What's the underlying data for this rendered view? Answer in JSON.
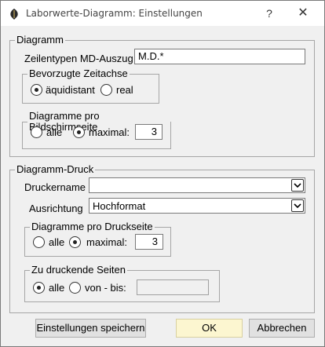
{
  "window": {
    "title": "Laborwerte-Diagramm: Einstellungen",
    "help_label": "?",
    "close_label": "✕"
  },
  "diagramm": {
    "legend": "Diagramm",
    "zeilentypen_label": "Zeilentypen MD-Auszug",
    "zeilentypen_value": "M.D.*",
    "zeitachse": {
      "legend": "Bevorzugte Zeitachse",
      "options": [
        "äquidistant",
        "real"
      ],
      "selected": "äquidistant"
    },
    "pro_bildschirmseite": {
      "legend": "Diagramme pro Bildschirmseite",
      "alle_label": "alle",
      "maximal_label": "maximal:",
      "selected": "maximal",
      "maximal_value": "3"
    }
  },
  "druck": {
    "legend": "Diagramm-Druck",
    "druckername_label": "Druckername",
    "druckername_value": "",
    "ausrichtung_label": "Ausrichtung",
    "ausrichtung_value": "Hochformat",
    "pro_druckseite": {
      "legend": "Diagramme pro Druckseite",
      "alle_label": "alle",
      "maximal_label": "maximal:",
      "selected": "maximal",
      "maximal_value": "3"
    },
    "seiten": {
      "legend": "Zu druckende Seiten",
      "alle_label": "alle",
      "von_bis_label": "von - bis:",
      "selected": "alle",
      "von_bis_value": ""
    }
  },
  "buttons": {
    "save": "Einstellungen speichern",
    "ok": "OK",
    "cancel": "Abbrechen"
  },
  "colors": {
    "ok_button_bg": "#fcf6d0",
    "dialog_bg": "#f0f0f0"
  }
}
